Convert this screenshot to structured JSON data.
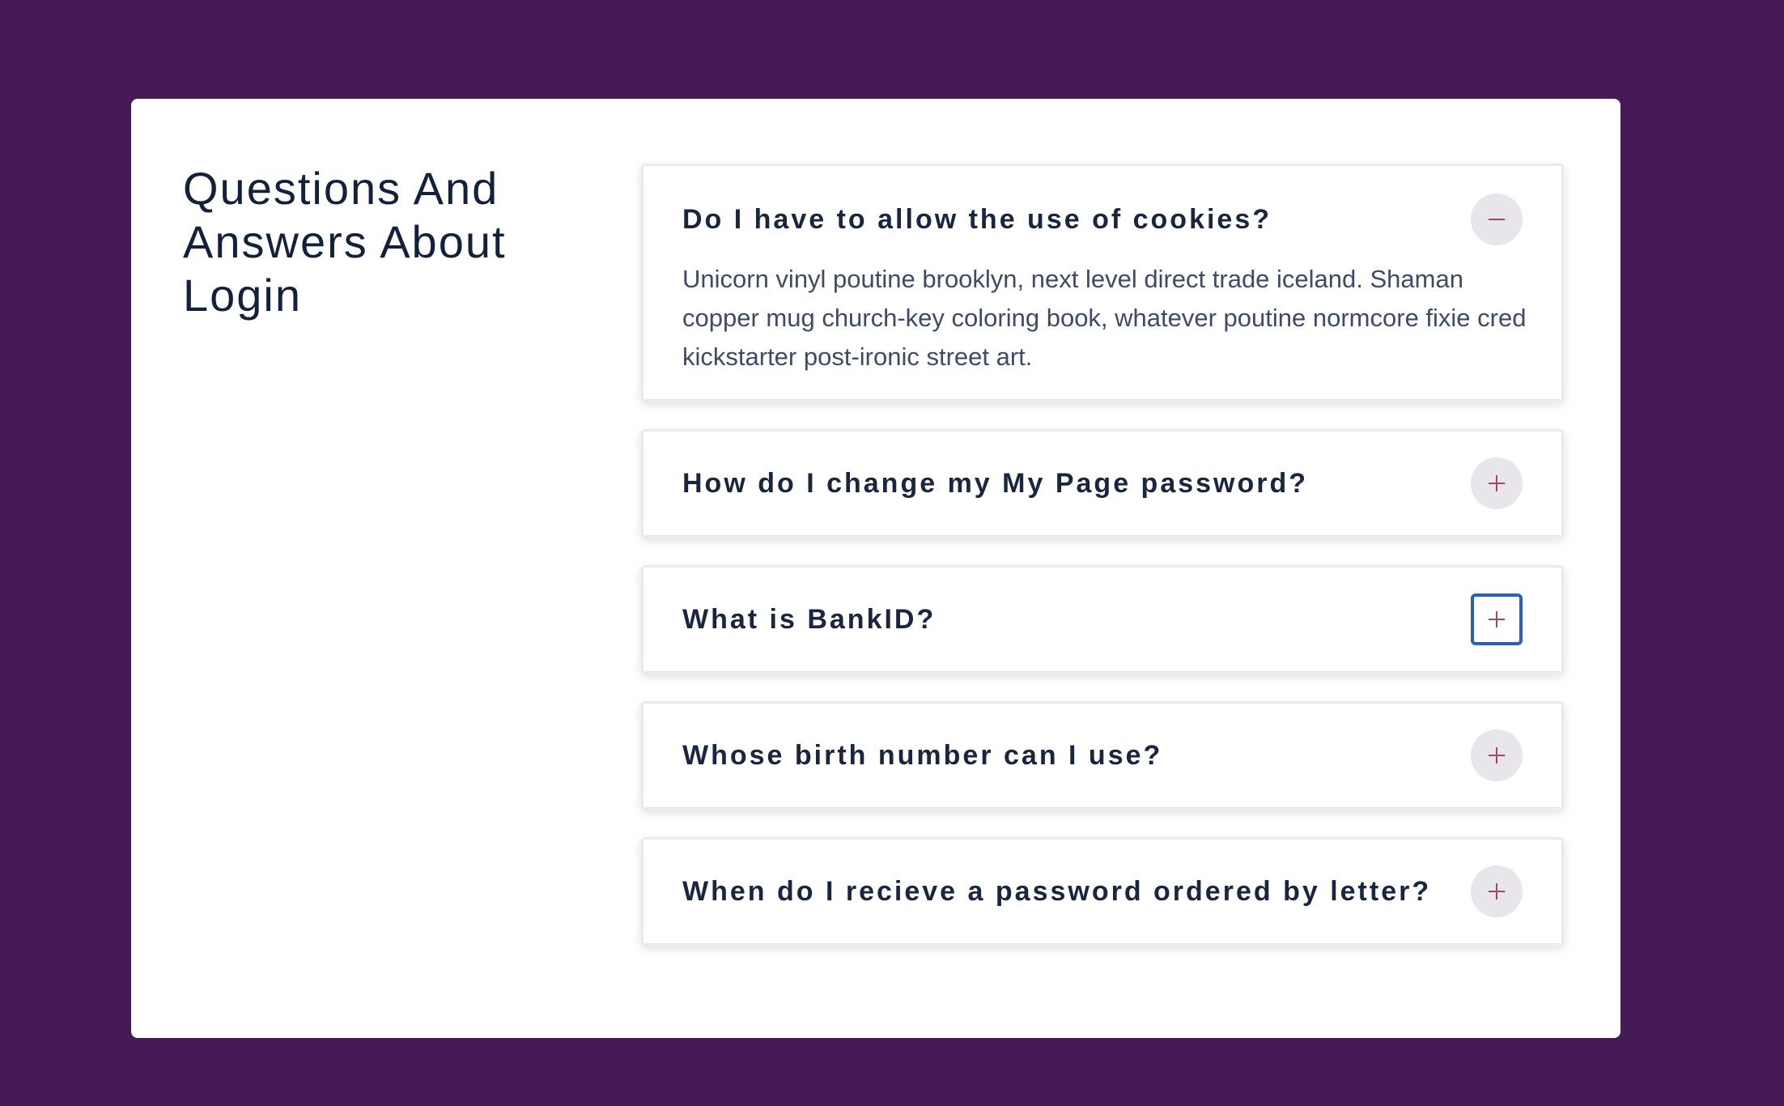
{
  "page": {
    "heading": "Questions And Answers About Login"
  },
  "faq": [
    {
      "question": "Do I have to allow the use of cookies?",
      "answer": "Unicorn vinyl poutine brooklyn, next level direct trade iceland. Shaman copper mug church-key coloring book, whatever poutine normcore fixie cred kickstarter post-ironic street art.",
      "expanded": true,
      "toggle_icon": "minus-icon"
    },
    {
      "question": "How do I change my My Page password?",
      "expanded": false,
      "toggle_icon": "plus-icon"
    },
    {
      "question": "What is BankID?",
      "expanded": false,
      "focused": true,
      "toggle_icon": "plus-icon"
    },
    {
      "question": "Whose birth number can I use?",
      "expanded": false,
      "toggle_icon": "plus-icon"
    },
    {
      "question": "When do I recieve a password ordered by letter?",
      "expanded": false,
      "toggle_icon": "plus-icon"
    }
  ],
  "colors": {
    "background": "#461a56",
    "card": "#ffffff",
    "heading": "#14213a",
    "icon_accent": "#a3456a",
    "focus_ring": "#2c5fb8"
  }
}
